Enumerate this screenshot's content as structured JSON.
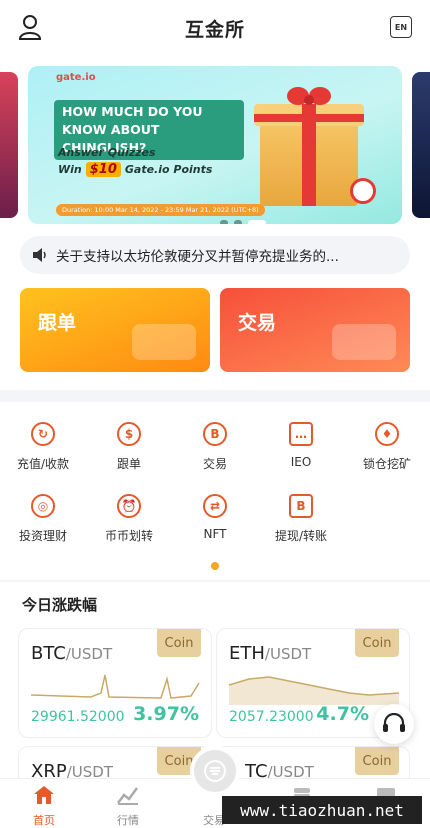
{
  "header": {
    "title": "互金所",
    "lang_label": "EN"
  },
  "banner": {
    "brand": "gate.io",
    "headline": "HOW MUCH DO YOU KNOW ABOUT CHINGLISH?",
    "line1": "Answer Quizzes",
    "line2_prefix": "Win",
    "amount": "$10",
    "line2_suffix": "Gate.io Points",
    "duration": "Duration: 10:00 Mar 14, 2022 - 23:59 Mar 21, 2022 (UTC+8)"
  },
  "notice": {
    "text": "关于支持以太坊伦敦硬分叉并暂停充提业务的..."
  },
  "actions": {
    "follow_label": "跟单",
    "trade_label": "交易"
  },
  "menu": {
    "items": [
      {
        "label": "充值/收款",
        "icon": "deposit-icon"
      },
      {
        "label": "跟单",
        "icon": "follow-icon"
      },
      {
        "label": "交易",
        "icon": "trade-icon"
      },
      {
        "label": "IEO",
        "icon": "ieo-icon"
      },
      {
        "label": "锁仓挖矿",
        "icon": "mining-icon"
      },
      {
        "label": "投资理财",
        "icon": "invest-icon"
      },
      {
        "label": "币币划转",
        "icon": "transfer-icon"
      },
      {
        "label": "NFT",
        "icon": "nft-icon"
      },
      {
        "label": "提现/转账",
        "icon": "withdraw-icon"
      }
    ]
  },
  "market": {
    "title": "今日涨跌幅",
    "coins": [
      {
        "base": "BTC",
        "quote": "/USDT",
        "tag": "Coin",
        "price": "29961.52000",
        "change": "3.97%"
      },
      {
        "base": "ETH",
        "quote": "/USDT",
        "tag": "Coin",
        "price": "2057.23000",
        "change": "4.7%"
      },
      {
        "base": "XRP",
        "quote": "/USDT",
        "tag": "Coin",
        "price": "",
        "change": ""
      },
      {
        "base": "TC",
        "quote": "/USDT",
        "tag": "Coin",
        "price": "",
        "change": ""
      }
    ]
  },
  "tabbar": {
    "home": "首页",
    "quotes": "行情",
    "trade": "交易",
    "assets": ""
  },
  "watermark": "www.tiaozhuan.net",
  "colors": {
    "accent": "#e45a2b",
    "up": "#3fc3a0",
    "coin_tag": "#e7cf9e"
  }
}
